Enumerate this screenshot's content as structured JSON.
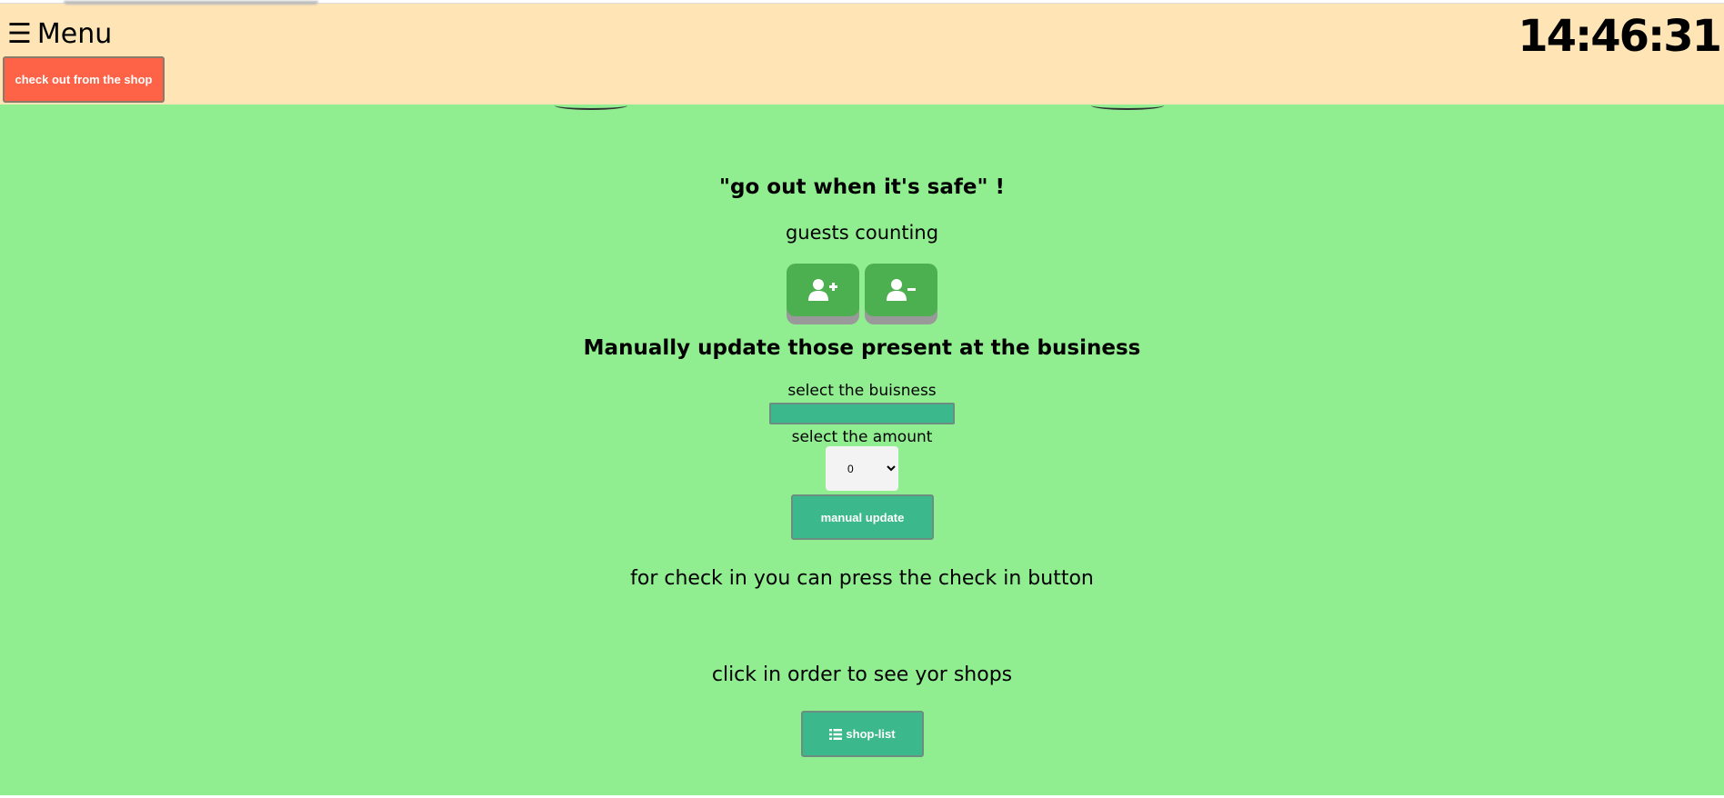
{
  "header": {
    "menu_icon": "hamburger-icon",
    "menu_label": "Menu",
    "clock": "14:46:31",
    "checkout_label": "check out from the shop"
  },
  "main": {
    "slogan": "\"go out when it's safe\" !",
    "guests_title": "guests counting",
    "add_guest_icon": "user-plus-icon",
    "remove_guest_icon": "user-minus-icon",
    "manual_title": "Manually update those present at the business",
    "business_label": "select the buisness",
    "business_value": "",
    "amount_label": "select the amount",
    "amount_selected": "0",
    "manual_button": "manual update",
    "checkin_text": "for check in you can press the check in button",
    "shops_text": "click in order to see yor shops",
    "shoplist_icon": "list-icon",
    "shoplist_button": "shop-list"
  },
  "colors": {
    "header_bg": "#ffe4b5",
    "main_bg": "#90ee90",
    "checkout_btn": "#ff6347",
    "guest_btn": "#4caf50",
    "action_btn": "#3cb98c"
  }
}
